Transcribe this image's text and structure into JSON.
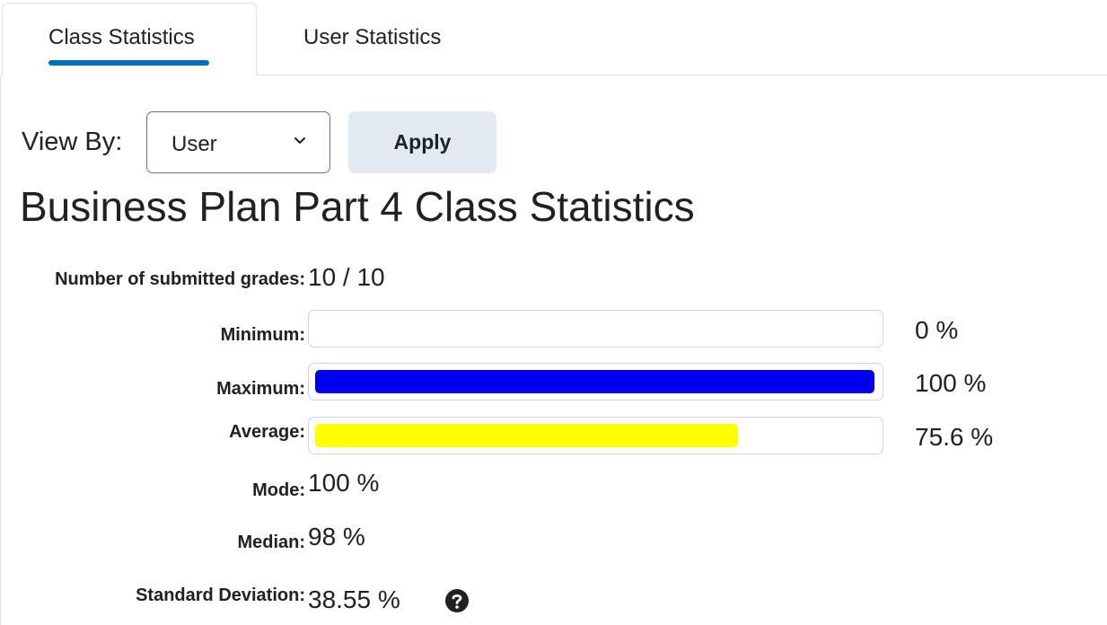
{
  "tabs": [
    {
      "label": "Class Statistics",
      "active": true
    },
    {
      "label": "User Statistics",
      "active": false
    }
  ],
  "filter": {
    "view_by_label": "View By:",
    "selected": "User",
    "apply_label": "Apply"
  },
  "title": "Business Plan Part 4 Class Statistics",
  "stats": {
    "submitted": {
      "label": "Number of submitted grades:",
      "value": "10 / 10"
    },
    "minimum": {
      "label": "Minimum:",
      "value": "0 %",
      "fraction": 0.0
    },
    "maximum": {
      "label": "Maximum:",
      "value": "100 %",
      "fraction": 1.0,
      "color": "#0000ee"
    },
    "average": {
      "label": "Average:",
      "value": "75.6 %",
      "fraction": 0.756,
      "color": "#ffff00"
    },
    "mode": {
      "label": "Mode:",
      "value": "100 %"
    },
    "median": {
      "label": "Median:",
      "value": "98 %"
    },
    "std_dev": {
      "label": "Standard Deviation:",
      "value": "38.55 %"
    }
  },
  "icons": {
    "select_chevron": "chevron-down-icon",
    "help": "help-icon"
  },
  "colors": {
    "tab_indicator": "#006fbf",
    "apply_button_bg": "#e3e9f1"
  }
}
